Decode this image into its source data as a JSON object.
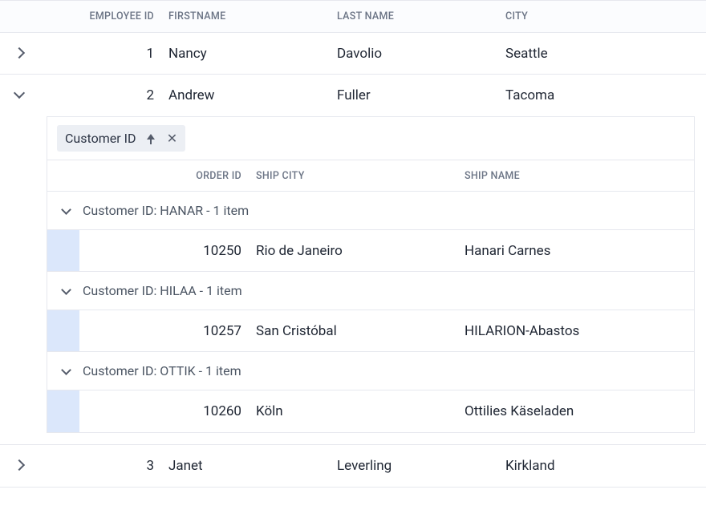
{
  "outer": {
    "headers": {
      "employee_id": "EMPLOYEE ID",
      "first_name": "FIRSTNAME",
      "last_name": "LAST NAME",
      "city": "CITY"
    },
    "rows": [
      {
        "id": "1",
        "first": "Nancy",
        "last": "Davolio",
        "city": "Seattle",
        "expanded": false
      },
      {
        "id": "2",
        "first": "Andrew",
        "last": "Fuller",
        "city": "Tacoma",
        "expanded": true
      },
      {
        "id": "3",
        "first": "Janet",
        "last": "Leverling",
        "city": "Kirkland",
        "expanded": false
      }
    ]
  },
  "detail": {
    "group_chip": {
      "label": "Customer ID",
      "sort": "asc"
    },
    "headers": {
      "order_id": "ORDER ID",
      "ship_city": "SHIP CITY",
      "ship_name": "SHIP NAME"
    },
    "groups": [
      {
        "label": "Customer ID: HANAR - 1 item",
        "rows": [
          {
            "order_id": "10250",
            "ship_city": "Rio de Janeiro",
            "ship_name": "Hanari Carnes"
          }
        ]
      },
      {
        "label": "Customer ID: HILAA - 1 item",
        "rows": [
          {
            "order_id": "10257",
            "ship_city": "San Cristóbal",
            "ship_name": "HILARION-Abastos"
          }
        ]
      },
      {
        "label": "Customer ID: OTTIK - 1 item",
        "rows": [
          {
            "order_id": "10260",
            "ship_city": "Köln",
            "ship_name": "Ottilies Käseladen"
          }
        ]
      }
    ]
  }
}
